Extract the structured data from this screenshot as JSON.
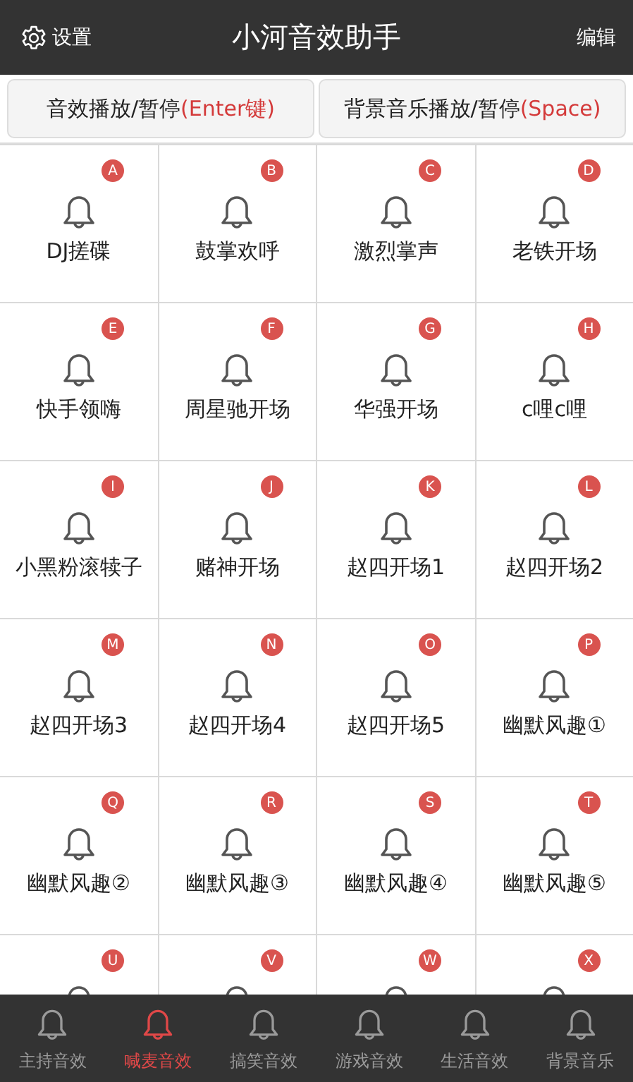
{
  "header": {
    "settings_label": "设置",
    "title": "小河音效助手",
    "edit_label": "编辑"
  },
  "controls": [
    {
      "label": "音效播放/暂停",
      "key": "(Enter键)"
    },
    {
      "label": "背景音乐播放/暂停",
      "key": "(Space)"
    }
  ],
  "sounds": [
    {
      "key": "A",
      "label": "DJ搓碟"
    },
    {
      "key": "B",
      "label": "鼓掌欢呼"
    },
    {
      "key": "C",
      "label": "激烈掌声"
    },
    {
      "key": "D",
      "label": "老铁开场"
    },
    {
      "key": "E",
      "label": "快手领嗨"
    },
    {
      "key": "F",
      "label": "周星驰开场"
    },
    {
      "key": "G",
      "label": "华强开场"
    },
    {
      "key": "H",
      "label": "c哩c哩"
    },
    {
      "key": "I",
      "label": "小黑粉滚犊子"
    },
    {
      "key": "J",
      "label": "赌神开场"
    },
    {
      "key": "K",
      "label": "赵四开场1"
    },
    {
      "key": "L",
      "label": "赵四开场2"
    },
    {
      "key": "M",
      "label": "赵四开场3"
    },
    {
      "key": "N",
      "label": "赵四开场4"
    },
    {
      "key": "O",
      "label": "赵四开场5"
    },
    {
      "key": "P",
      "label": "幽默风趣①"
    },
    {
      "key": "Q",
      "label": "幽默风趣②"
    },
    {
      "key": "R",
      "label": "幽默风趣③"
    },
    {
      "key": "S",
      "label": "幽默风趣④"
    },
    {
      "key": "T",
      "label": "幽默风趣⑤"
    },
    {
      "key": "U"
    },
    {
      "key": "V"
    },
    {
      "key": "W"
    },
    {
      "key": "X"
    }
  ],
  "tabs": [
    {
      "label": "主持音效",
      "selected": false
    },
    {
      "label": "喊麦音效",
      "selected": true
    },
    {
      "label": "搞笑音效",
      "selected": false
    },
    {
      "label": "游戏音效",
      "selected": false
    },
    {
      "label": "生活音效",
      "selected": false
    },
    {
      "label": "背景音乐",
      "selected": false
    }
  ]
}
